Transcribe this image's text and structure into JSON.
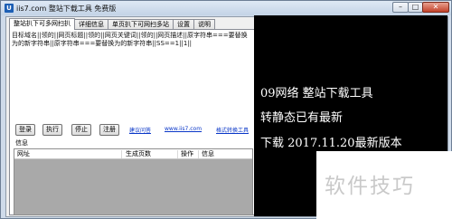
{
  "window": {
    "title": "iis7.com 整站下载工具 免费版",
    "icon_glyph": "U",
    "minimize_glyph": "–",
    "maximize_glyph": "□",
    "close_glyph": "✕"
  },
  "tabs": [
    {
      "label": "整站扒下可多网扫扒"
    },
    {
      "label": "详细信息"
    },
    {
      "label": "单页扒下可网扫多站"
    },
    {
      "label": "设置"
    },
    {
      "label": "说明"
    }
  ],
  "format_text": "目标域名||领的||网页标题||领的||网页关键词||领的||网页描述||原字符串===要替换为的新字符串||原字符串===要替换为的新字符串||SS==1||1||",
  "buttons": {
    "login": "登录",
    "execute": "执行",
    "stop": "停止",
    "register": "注册"
  },
  "links": {
    "suggestion": "建议问答",
    "site": "www.iis7.com",
    "format_tool": "格式转换工具"
  },
  "info_label": "信息",
  "table": {
    "columns": [
      "网址",
      "生成页数",
      "操作",
      "信息"
    ]
  },
  "promo": {
    "line1": "09网络 整站下载工具",
    "line2": "转静态已有最新",
    "line3": "下载 2017.11.20最新版本"
  },
  "watermark": "软件技巧",
  "colors": {
    "promo_bg": "#000000",
    "promo_text": "#ffffff",
    "link": "#0a37c8",
    "table_bg": "#a9a9a9"
  }
}
